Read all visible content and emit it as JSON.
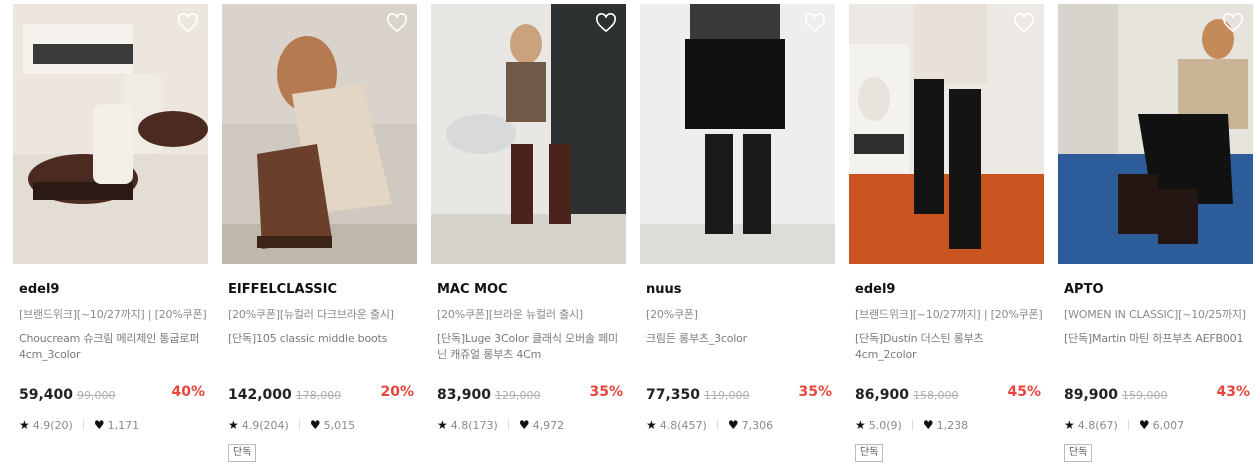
{
  "products": [
    {
      "brand": "edel9",
      "promo": "[브랜드위크][~10/27까지] | [20%쿠폰]",
      "title": "Choucream 슈크림 메리제인 통굽로퍼 4cm_3color",
      "price": "59,400",
      "original_price": "99,000",
      "discount": "40%",
      "rating": "4.9(20)",
      "likes": "1,171",
      "tag": "",
      "icon": "heart-outline-icon"
    },
    {
      "brand": "EIFFELCLASSIC",
      "promo": "[20%쿠폰][뉴컬러 다크브라운 출시]",
      "title": "[단독]105 classic middle boots",
      "price": "142,000",
      "original_price": "178,000",
      "discount": "20%",
      "rating": "4.9(204)",
      "likes": "5,015",
      "tag": "단독",
      "icon": "heart-outline-icon"
    },
    {
      "brand": "MAC MOC",
      "promo": "[20%쿠폰][브라운 뉴컬러 출시]",
      "title": "[단독]Luge 3Color 클래식 오버솔 페미닌 캐쥬얼 롱부츠 4Cm",
      "price": "83,900",
      "original_price": "129,000",
      "discount": "35%",
      "rating": "4.8(173)",
      "likes": "4,972",
      "tag": "",
      "icon": "heart-outline-icon"
    },
    {
      "brand": "nuus",
      "promo": "[20%쿠폰]",
      "title": "크림든 롱부츠_3color",
      "price": "77,350",
      "original_price": "119,000",
      "discount": "35%",
      "rating": "4.8(457)",
      "likes": "7,306",
      "tag": "",
      "icon": "heart-outline-icon"
    },
    {
      "brand": "edel9",
      "promo": "[브랜드위크][~10/27까지] | [20%쿠폰]",
      "title": "[단독]Dustin 더스틴 롱부츠 4cm_2color",
      "price": "86,900",
      "original_price": "158,000",
      "discount": "45%",
      "rating": "5.0(9)",
      "likes": "1,238",
      "tag": "단독",
      "icon": "heart-outline-icon"
    },
    {
      "brand": "APTO",
      "promo": "[WOMEN IN CLASSIC][~10/25까지]",
      "title": "[단독]Martin 마틴 하프부츠 AEFB001",
      "price": "89,900",
      "original_price": "159,000",
      "discount": "43%",
      "rating": "4.8(67)",
      "likes": "6,007",
      "tag": "단독",
      "icon": "heart-outline-icon"
    }
  ],
  "colors": {
    "discount": "#e8453c",
    "muted": "#8a8a8a"
  }
}
